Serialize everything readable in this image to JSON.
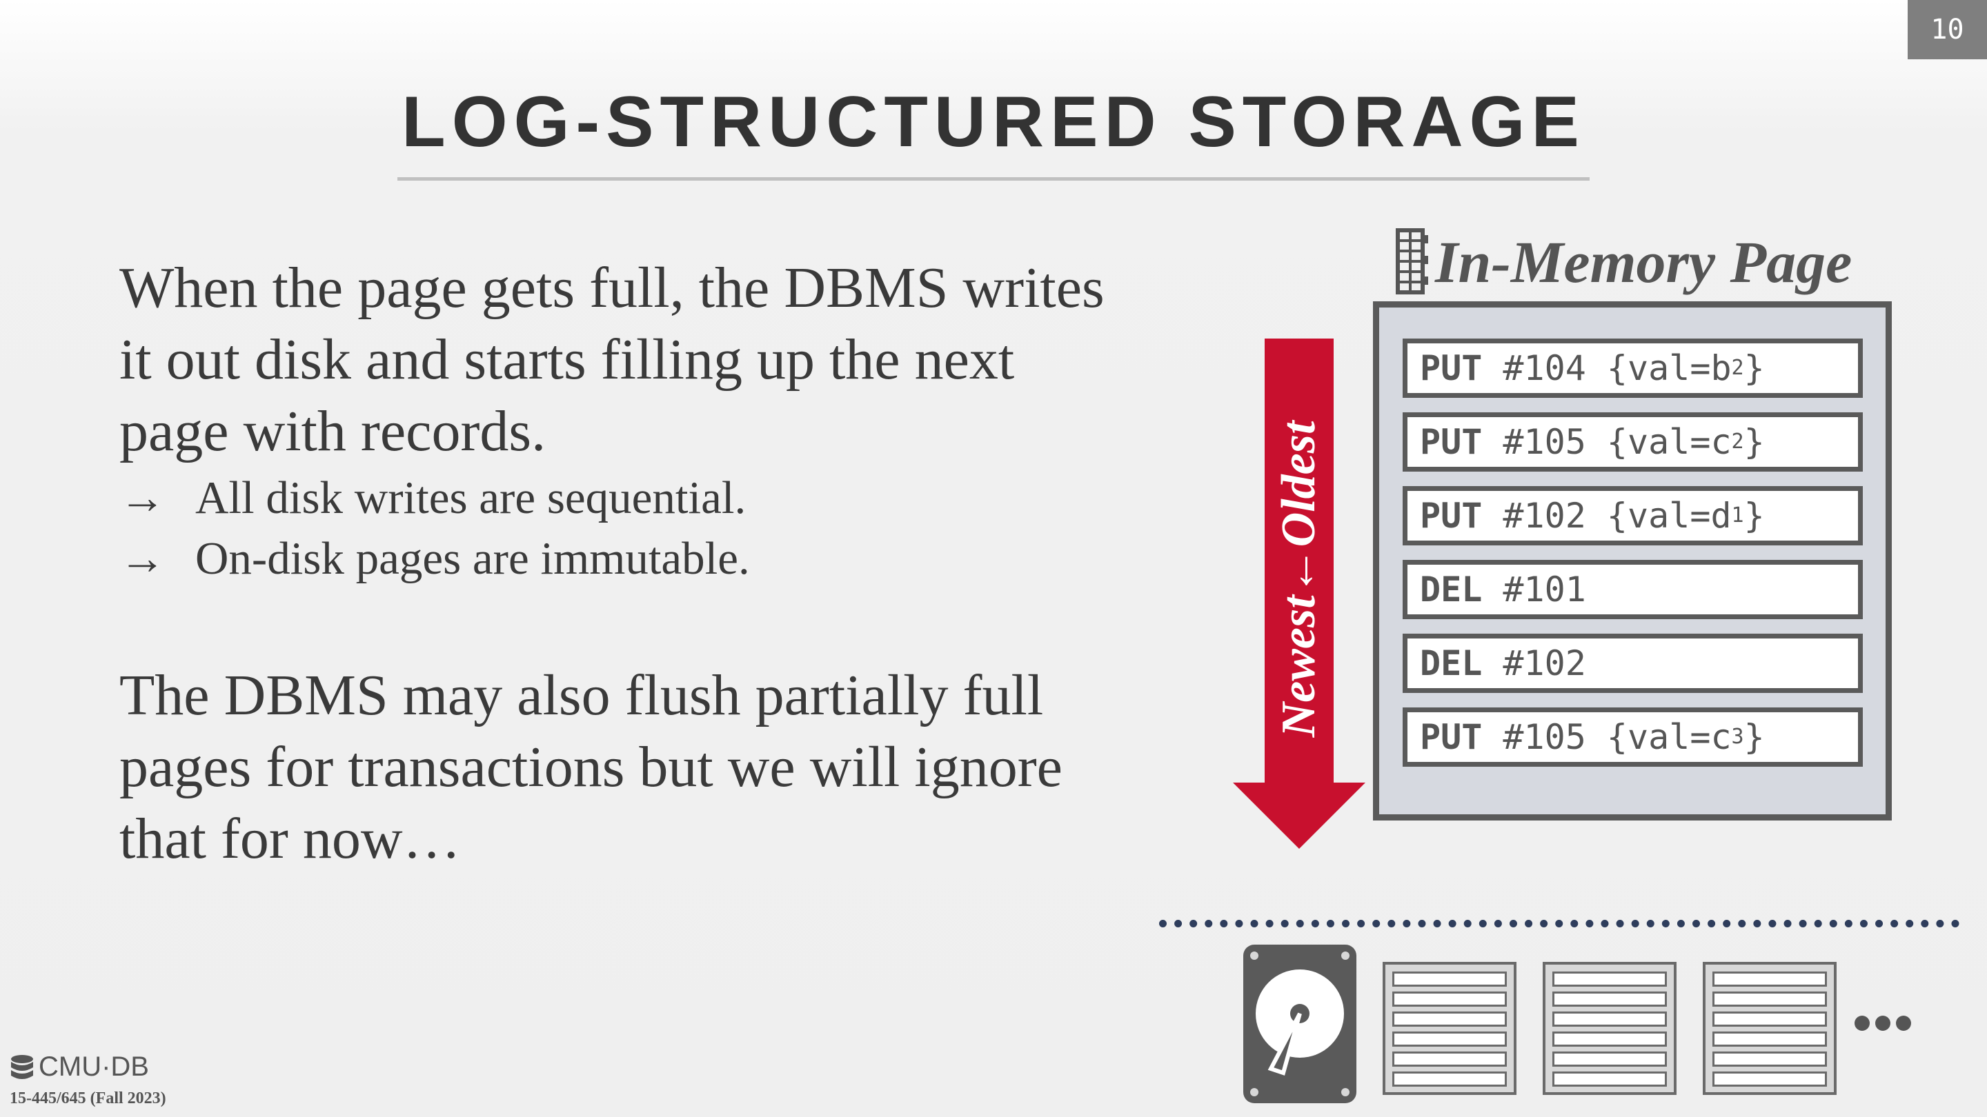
{
  "slide_number": "10",
  "title": "LOG-STRUCTURED STORAGE",
  "paragraph1": "When the page gets full, the DBMS writes it out disk and starts filling up the next page with records.",
  "bullets": [
    {
      "arrow": "→",
      "text": "All disk writes are sequential."
    },
    {
      "arrow": "→",
      "text": "On-disk pages are immutable."
    }
  ],
  "paragraph2": "The DBMS may also flush partially full pages for transactions but we will ignore that for now…",
  "arrow_label": "Newest←Oldest",
  "memory_page": {
    "title": "In-Memory Page",
    "records": [
      {
        "op": "PUT",
        "rest": " #104 {val=b",
        "sub": "2",
        "end": "}"
      },
      {
        "op": "PUT",
        "rest": " #105 {val=c",
        "sub": "2",
        "end": "}"
      },
      {
        "op": "PUT",
        "rest": " #102 {val=d",
        "sub": "1",
        "end": "}"
      },
      {
        "op": "DEL",
        "rest": " #101",
        "sub": "",
        "end": ""
      },
      {
        "op": "DEL",
        "rest": " #102",
        "sub": "",
        "end": ""
      },
      {
        "op": "PUT",
        "rest": " #105 {val=c",
        "sub": "3",
        "end": "}"
      }
    ]
  },
  "footer": {
    "logo_text": "CMU·DB",
    "course": "15-445/645 (Fall 2023)"
  },
  "icons": [
    "memory-chip-icon",
    "hard-drive-icon",
    "database-icon",
    "ellipsis-icon"
  ],
  "colors": {
    "accent": "#c8102e",
    "text": "#333333",
    "box_fill": "#d6d9e0"
  }
}
